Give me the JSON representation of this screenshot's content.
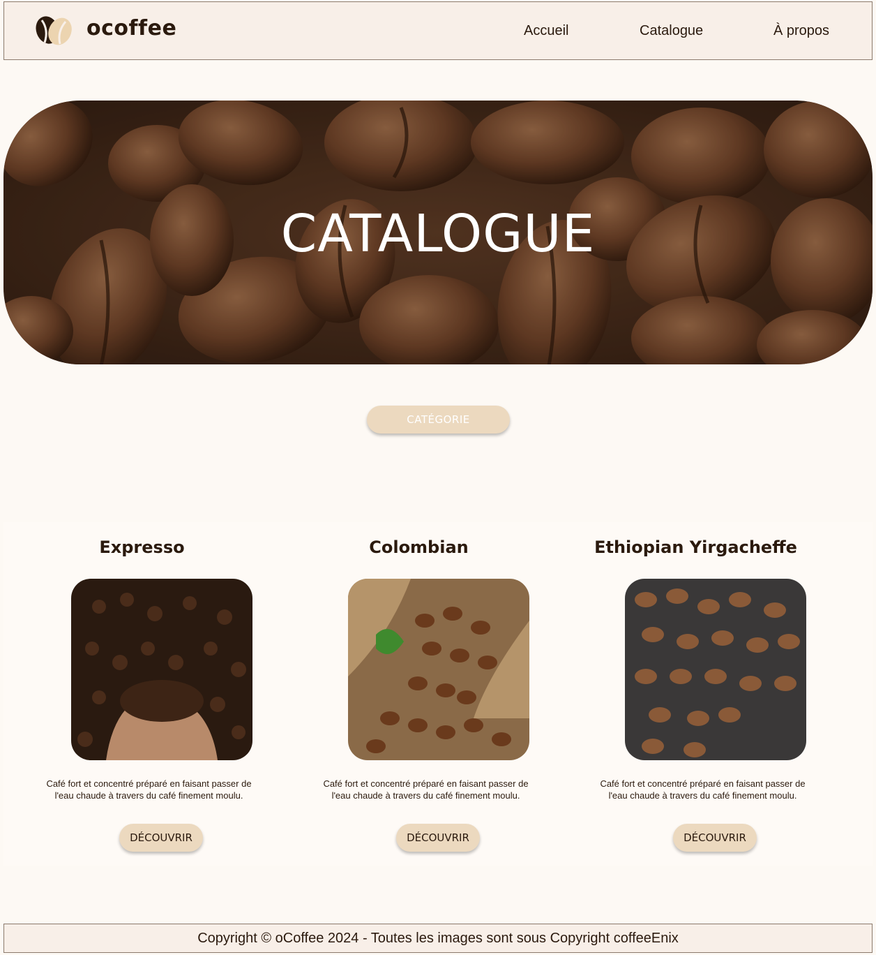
{
  "header": {
    "brand": "ocoffee",
    "nav": [
      {
        "label": "Accueil"
      },
      {
        "label": "Catalogue"
      },
      {
        "label": "À propos"
      }
    ]
  },
  "hero": {
    "title": "CATALOGUE"
  },
  "category_button": {
    "label": "CATÉGORIE"
  },
  "products": [
    {
      "name": "Expresso",
      "description_line1": "Café fort et concentré préparé en faisant passer de",
      "description_line2": "l'eau chaude à travers du café finement moulu.",
      "button": "DÉCOUVRIR"
    },
    {
      "name": "Colombian",
      "description_line1": "Café fort et concentré préparé en faisant passer de",
      "description_line2": "l'eau chaude à travers du café finement moulu.",
      "button": "DÉCOUVRIR"
    },
    {
      "name": "Ethiopian Yirgacheffe",
      "description_line1": "Café fort et concentré préparé en faisant passer de",
      "description_line2": "l'eau chaude à travers du café finement moulu.",
      "button": "DÉCOUVRIR"
    }
  ],
  "footer": {
    "text": "Copyright © oCoffee 2024 - Toutes les images sont sous Copyright coffeeEnix"
  },
  "colors": {
    "background": "#fdf9f4",
    "header_bg": "#f8efe8",
    "button_bg": "#ecd9bf",
    "text_dark": "#2b1a0e"
  }
}
